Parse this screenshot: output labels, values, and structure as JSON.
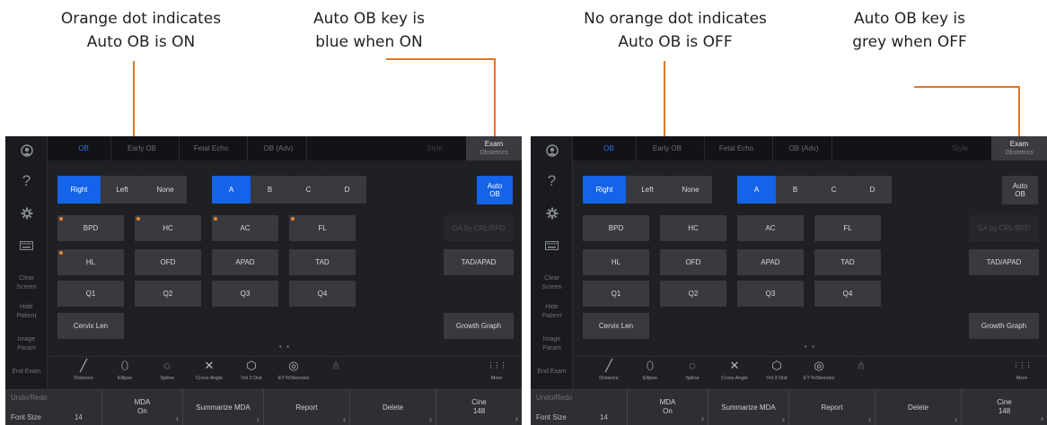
{
  "captions": {
    "left_dot_on": [
      "Orange dot indicates",
      "Auto OB is ON"
    ],
    "left_key_on": [
      "Auto OB key is",
      "blue when ON"
    ],
    "right_dot_off": [
      "No orange dot indicates",
      "Auto OB is OFF"
    ],
    "right_key_off": [
      "Auto OB key is",
      "grey when OFF"
    ]
  },
  "colors": {
    "accent_blue": "#1463e8",
    "orange": "#e07524",
    "dot": "#e8872e",
    "panel_bg": "#1f2024",
    "button_grey": "#393a3f"
  },
  "tabs": [
    "OB",
    "Early OB",
    "Fetal Echo",
    "OB (Adv)",
    "Style"
  ],
  "exam": {
    "title": "Exam",
    "subtitle": "Obstetrics"
  },
  "sidebar": {
    "icons": [
      "user-icon",
      "help-icon",
      "gear-icon",
      "keyboard-icon"
    ],
    "help_glyph": "?",
    "items": [
      [
        "Clear",
        "Screen"
      ],
      [
        "Hide",
        "Patient"
      ],
      [
        "Image",
        "Param"
      ],
      [
        "End Exam"
      ]
    ]
  },
  "side_options": [
    "Right",
    "Left",
    "None"
  ],
  "fetus_options": [
    "A",
    "B",
    "C",
    "D"
  ],
  "auto_ob": [
    "Auto",
    "OB"
  ],
  "measurements": [
    [
      "BPD",
      "HC",
      "AC",
      "FL"
    ],
    [
      "HL",
      "OFD",
      "APAD",
      "TAD"
    ],
    [
      "Q1",
      "Q2",
      "Q3",
      "Q4"
    ]
  ],
  "cervix_len": "Cervix Len",
  "ga_by": "GA by CRL/BPD",
  "tad_apad": "TAD/APAD",
  "growth_graph": "Growth Graph",
  "pager": "• •",
  "tools": [
    {
      "icon": "distance-icon",
      "glyph": "╱",
      "label": "Distance"
    },
    {
      "icon": "ellipse-icon",
      "glyph": "⬯",
      "label": "Ellipse"
    },
    {
      "icon": "spline-icon",
      "glyph": "◌",
      "label": "Spline"
    },
    {
      "icon": "cross-angle-icon",
      "glyph": "✕",
      "label": "Cross Angle"
    },
    {
      "icon": "vol-3dist-icon",
      "glyph": "⬡",
      "label": "Vol 3 Dist"
    },
    {
      "icon": "et-stenosis-icon",
      "glyph": "◎",
      "label": "ET-%Stenosis"
    },
    {
      "icon": "share-icon",
      "glyph": "⋔",
      "label": ""
    }
  ],
  "more": {
    "icon": "more-grid-icon",
    "glyph": "⋮⋮⋮",
    "label": "More"
  },
  "bottom": {
    "undo_redo": "Undo/Redo",
    "font_size_label": "Font Size",
    "font_size_value": "14",
    "mda": [
      "MDA",
      "On"
    ],
    "summarize_mda": "Summarize MDA",
    "report": "Report",
    "delete": "Delete",
    "cine": [
      "Cine",
      "148"
    ]
  },
  "panels": [
    {
      "id": "on",
      "auto_ob_on": true,
      "orange_dots": [
        "BPD",
        "HC",
        "AC",
        "FL",
        "HL"
      ]
    },
    {
      "id": "off",
      "auto_ob_on": false,
      "orange_dots": []
    }
  ]
}
